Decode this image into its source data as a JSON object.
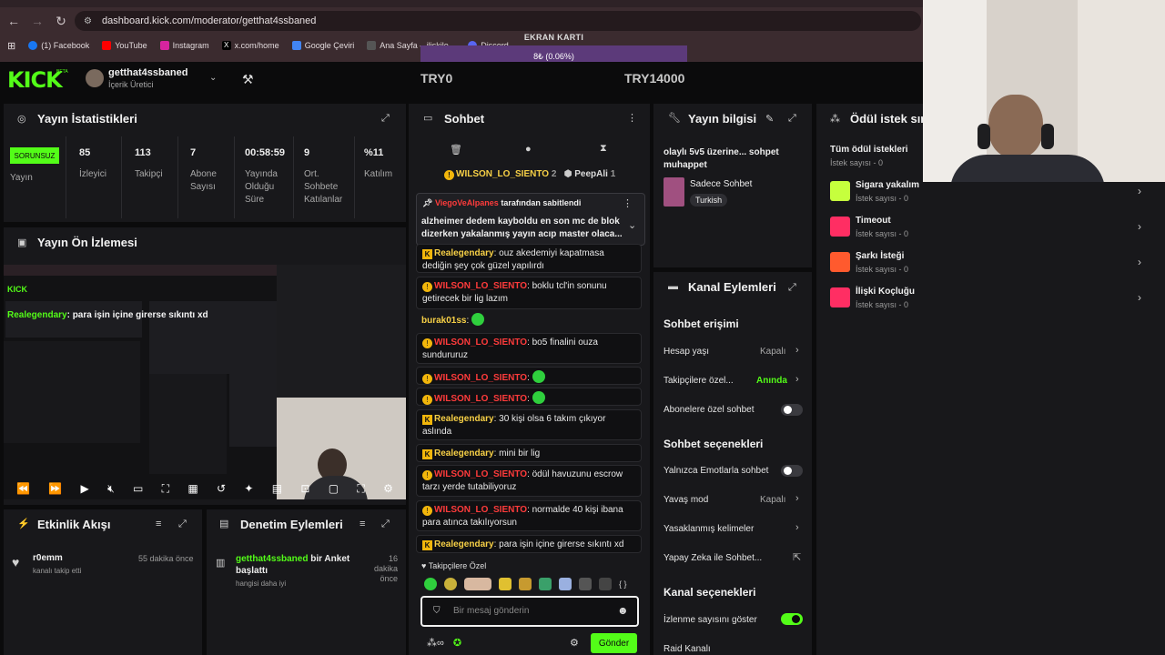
{
  "browser": {
    "url": "dashboard.kick.com/moderator/getthat4ssbaned",
    "bookmarks": [
      "(1) Facebook",
      "YouTube",
      "Instagram",
      "x.com/home",
      "Google Çeviri",
      "Ana Sayfa – ilişkile...",
      "Discord"
    ]
  },
  "overlay": {
    "title": "EKRAN KARTI",
    "progress_text": "8₺ (0.06%)",
    "progress": 0.0006,
    "min": "TRY0",
    "max": "TRY14000"
  },
  "header": {
    "logo": "KICK",
    "beta": "BETA",
    "channel_name": "getthat4ssbaned",
    "channel_role": "İçerik Üretici"
  },
  "stats": {
    "title": "Yayın İstatistikleri",
    "status": "SORUNSUZ",
    "status_label": "Yayın",
    "items": [
      {
        "value": "85",
        "label": "İzleyici"
      },
      {
        "value": "113",
        "label": "Takipçi"
      },
      {
        "value": "7",
        "label": "Abone Sayısı"
      },
      {
        "value": "00:58:59",
        "label": "Yayında Olduğu Süre"
      },
      {
        "value": "9",
        "label": "Ort. Sohbete Katılanlar"
      },
      {
        "value": "%11",
        "label": "Katılım"
      }
    ]
  },
  "preview": {
    "title": "Yayın Ön İzlemesi",
    "overlay_user": "Realegendary",
    "overlay_text": ": para işin içine girerse sıkıntı xd"
  },
  "activity": {
    "title": "Etkinlik Akışı",
    "items": [
      {
        "user": "r0emm",
        "action": "kanalı takip etti",
        "time": "55 dakika önce"
      }
    ]
  },
  "moderation": {
    "title": "Denetim Eylemleri",
    "items": [
      {
        "user": "getthat4ssbaned",
        "action": "bir Anket başlattı",
        "detail": "hangisi daha iyi",
        "time": "16 dakika önce"
      }
    ]
  },
  "chat": {
    "title": "Sohbet",
    "top_gifters": [
      {
        "name": "WILSON_LO_SIENTO",
        "count": "2"
      },
      {
        "name": "PeepAli",
        "count": "1"
      }
    ],
    "pinned": {
      "by": "ViegoVeAlpanes",
      "by_suffix": "tarafından sabitlendi",
      "text": "alzheimer dedem kayboldu en son mc de blok dizerken yakalanmış yayın acıp master olaca..."
    },
    "messages": [
      {
        "user": "Realegendary",
        "color": "yel",
        "badge": "k",
        "text": "ouz akedemiyi kapatmasa dediğin şey çok güzel yapılırdı"
      },
      {
        "user": "WILSON_LO_SIENTO",
        "color": "red",
        "badge": "y",
        "text": "boklu tcl'in sonunu getirecek bir lig lazım"
      },
      {
        "user": "burak01ss",
        "color": "yel",
        "badge": "",
        "text": ""
      },
      {
        "user": "WILSON_LO_SIENTO",
        "color": "red",
        "badge": "y",
        "text": "bo5 finalini ouza sundururuz"
      },
      {
        "user": "WILSON_LO_SIENTO",
        "color": "red",
        "badge": "y",
        "text": ""
      },
      {
        "user": "WILSON_LO_SIENTO",
        "color": "red",
        "badge": "y",
        "text": ""
      },
      {
        "user": "Realegendary",
        "color": "yel",
        "badge": "k",
        "text": "30 kişi olsa 6 takım çıkıyor aslında"
      },
      {
        "user": "Realegendary",
        "color": "yel",
        "badge": "k",
        "text": "mini bir lig"
      },
      {
        "user": "WILSON_LO_SIENTO",
        "color": "red",
        "badge": "y",
        "text": "ödül havuzunu escrow tarzı yerde tutabiliyoruz"
      },
      {
        "user": "WILSON_LO_SIENTO",
        "color": "red",
        "badge": "y",
        "text": "normalde 40 kişi ibana para atınca takılıyorsun"
      },
      {
        "user": "Realegendary",
        "color": "yel",
        "badge": "k",
        "text": "para işin içine girerse sıkıntı xd"
      }
    ],
    "followers_only": "Takipçilere Özel",
    "input_placeholder": "Bir mesaj gönderin",
    "send": "Gönder"
  },
  "stream_info": {
    "title": "Yayın bilgisi",
    "stream_title": "olaylı 5v5 üzerine... sohpet muhappet",
    "category": "Sadece Sohbet",
    "tag": "Turkish"
  },
  "channel_actions": {
    "title": "Kanal Eylemleri",
    "chat_access": "Sohbet erişimi",
    "account_age": {
      "label": "Hesap yaşı",
      "value": "Kapalı"
    },
    "followers_only": {
      "label": "Takipçilere özel...",
      "value": "Anında"
    },
    "subs_only": "Abonelere özel sohbet",
    "chat_options": "Sohbet seçenekleri",
    "emotes_only": "Yalnızca Emotlarla sohbet",
    "slow_mode": {
      "label": "Yavaş mod",
      "value": "Kapalı"
    },
    "banned_words": "Yasaklanmış kelimeler",
    "ai": "Yapay Zeka ile Sohbet...",
    "channel_options": "Kanal seçenekleri",
    "show_viewers": "İzlenme sayısını göster",
    "raid": "Raid Kanalı"
  },
  "rewards": {
    "title": "Ödül istek sır",
    "all": "Tüm ödül istekleri",
    "all_count": "İstek sayısı - 0",
    "items": [
      {
        "name": "Sigara yakalım",
        "count": "İstek sayısı - 0",
        "color": "#c6ff3d"
      },
      {
        "name": "Timeout",
        "count": "İstek sayısı - 0",
        "color": "#ff2e63"
      },
      {
        "name": "Şarkı İsteği",
        "count": "İstek sayısı - 0",
        "color": "#ff5a2e"
      },
      {
        "name": "İlişki Koçluğu",
        "count": "İstek sayısı - 0",
        "color": "#ff2e63"
      }
    ]
  }
}
